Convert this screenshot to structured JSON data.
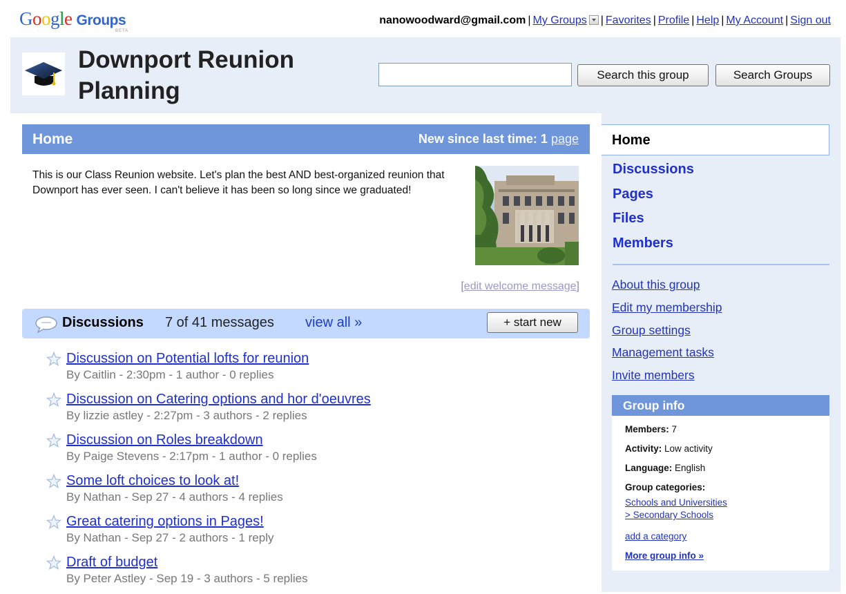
{
  "topbar": {
    "logo_google": "Google",
    "logo_groups": "Groups",
    "logo_beta": "BETA",
    "email": "nanowoodward@gmail.com",
    "links": {
      "my_groups": "My Groups",
      "favorites": "Favorites",
      "profile": "Profile",
      "help": "Help",
      "my_account": "My Account",
      "sign_out": "Sign out"
    }
  },
  "header": {
    "group_title": "Downport Reunion Planning",
    "search_placeholder": "",
    "search_value": "",
    "search_this_group": "Search this group",
    "search_groups": "Search Groups"
  },
  "home": {
    "title": "Home",
    "new_since_label": "New since last time:",
    "new_since_count": "1",
    "new_since_link": "page",
    "welcome_text": "This is our Class Reunion website. Let's plan the best AND best-organized reunion that Downport has ever seen. I can't believe it has been so long since we graduated!",
    "edit_welcome_open": "[",
    "edit_welcome": "edit welcome message",
    "edit_welcome_close": "]"
  },
  "discussions": {
    "title": "Discussions",
    "count": "7 of 41 messages",
    "view_all": "view all »",
    "start_new": "+ start new",
    "threads": [
      {
        "title": "Discussion on Potential lofts for reunion",
        "meta": "By Caitlin - 2:30pm - 1 author - 0 replies"
      },
      {
        "title": "Discussion on Catering options and hor d'oeuvres",
        "meta": "By lizzie astley - 2:27pm - 3 authors - 2 replies"
      },
      {
        "title": "Discussion on Roles breakdown",
        "meta": "By Paige Stevens - 2:17pm - 1 author - 0 replies"
      },
      {
        "title": "Some loft choices to look at!",
        "meta": "By Nathan - Sep 27 - 4 authors - 4 replies"
      },
      {
        "title": "Great catering options in Pages!",
        "meta": "By Nathan - Sep 27 - 2 authors - 1 reply"
      },
      {
        "title": "Draft of budget",
        "meta": "By Peter Astley - Sep 19 - 3 authors - 5 replies"
      }
    ]
  },
  "nav": {
    "home": "Home",
    "discussions": "Discussions",
    "pages": "Pages",
    "files": "Files",
    "members": "Members",
    "about": "About this group",
    "edit_membership": "Edit my membership",
    "settings": "Group settings",
    "management": "Management tasks",
    "invite": "Invite members"
  },
  "group_info": {
    "title": "Group info",
    "members_label": "Members:",
    "members_value": "7",
    "activity_label": "Activity:",
    "activity_value": "Low activity",
    "language_label": "Language:",
    "language_value": "English",
    "categories_label": "Group categories:",
    "category_line1": "Schools and Universities",
    "category_line2": "> Secondary Schools",
    "add_category": "add a category",
    "more_info": "More group info »"
  },
  "icons": {
    "group_logo": "graduation-cap-icon",
    "discussion": "speech-bubble-icon",
    "star": "star-outline-icon",
    "photo": "school-building-photo"
  },
  "colors": {
    "header_bg": "#e8eef7",
    "bar_blue": "#6f96db",
    "disc_bar": "#c3d9ff",
    "link": "#1f2fd0"
  }
}
